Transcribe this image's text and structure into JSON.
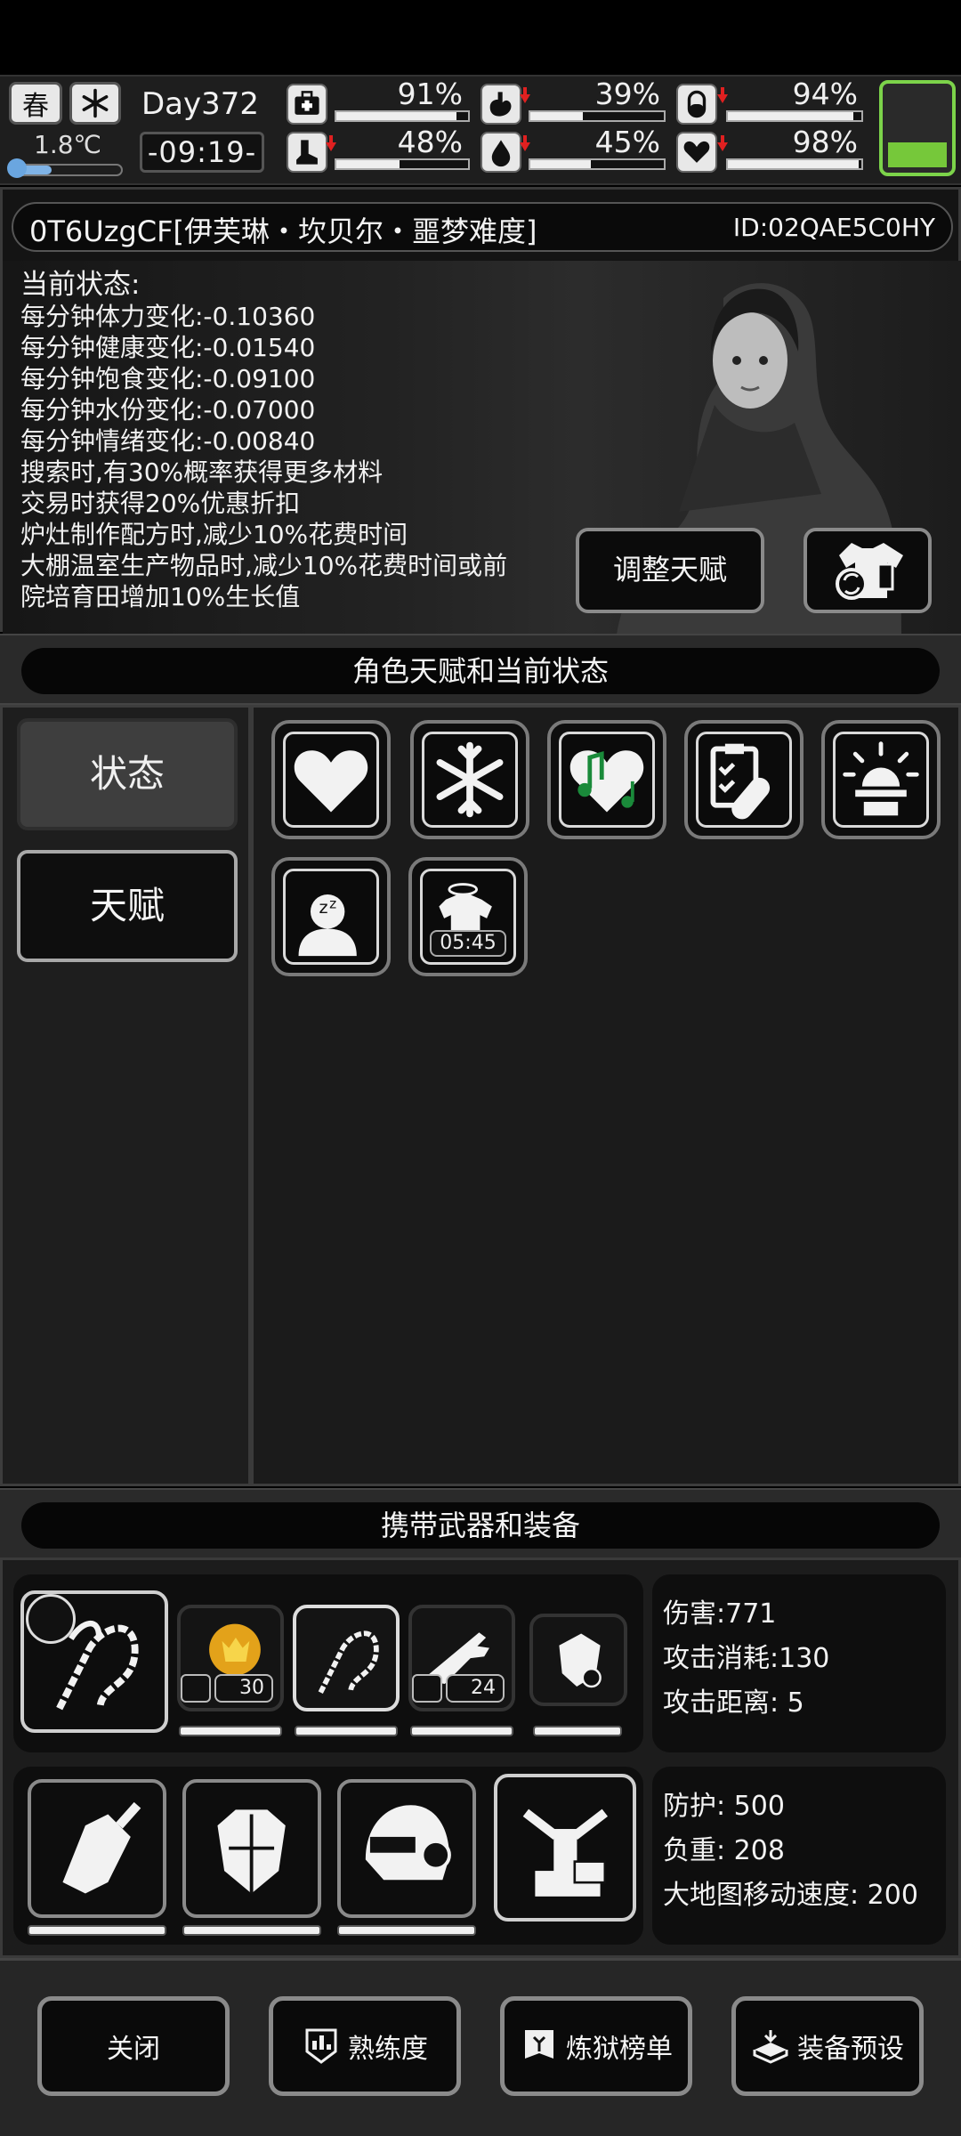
{
  "status_bar": {
    "season": "春",
    "temperature": "1.8℃",
    "temperature_level": 0.35,
    "day": "Day372",
    "time": "-09:19-",
    "battery_level": 0.28,
    "stats": [
      {
        "name": "health",
        "icon": "medkit-icon",
        "percent": "91%",
        "value": 0.91,
        "falling": false
      },
      {
        "name": "hunger",
        "icon": "stomach-icon",
        "percent": "39%",
        "value": 0.39,
        "falling": true
      },
      {
        "name": "medicine",
        "icon": "pill-icon",
        "percent": "94%",
        "value": 0.94,
        "falling": true
      },
      {
        "name": "stamina",
        "icon": "boot-icon",
        "percent": "48%",
        "value": 0.48,
        "falling": true
      },
      {
        "name": "water",
        "icon": "water-drop-icon",
        "percent": "45%",
        "value": 0.45,
        "falling": true
      },
      {
        "name": "mood",
        "icon": "heart-icon",
        "percent": "98%",
        "value": 0.98,
        "falling": true
      }
    ]
  },
  "character": {
    "name": "0T6UzgCF[伊芙琳・坎贝尔・噩梦难度]",
    "id": "ID:02QAE5C0HY",
    "status_title": "当前状态:",
    "status_lines": [
      "每分钟体力变化:-0.10360",
      "每分钟健康变化:-0.01540",
      "每分钟饱食变化:-0.09100",
      "每分钟水份变化:-0.07000",
      "每分钟情绪变化:-0.00840",
      "搜索时,有30%概率获得更多材料",
      "交易时获得20%优惠折扣",
      "炉灶制作配方时,减少10%花费时间",
      "大棚温室生产物品时,减少10%花费时间或前",
      "院培育田增加10%生长值"
    ],
    "adjust_talent_button": "调整天赋"
  },
  "talent_section": {
    "header": "角色天赋和当前状态",
    "tabs": [
      "状态",
      "天赋"
    ],
    "active_tab": "状态",
    "icons": [
      {
        "name": "heart-icon"
      },
      {
        "name": "snowflake-icon"
      },
      {
        "name": "music-heart-icon"
      },
      {
        "name": "clipboard-bandage-icon"
      },
      {
        "name": "alarm-light-icon"
      },
      {
        "name": "sleeping-person-icon"
      },
      {
        "name": "ghost-shirt-icon",
        "timer": "05:45"
      }
    ]
  },
  "equipment_section": {
    "header": "携带武器和装备",
    "weapons": [
      {
        "name": "bone-whip-icon",
        "durability": 0.9
      },
      {
        "name": "lion-emblem-icon",
        "count": "30",
        "durability": 0.95
      },
      {
        "name": "bone-whip-icon",
        "durability": 0.9
      },
      {
        "name": "rifle-icon",
        "count": "24",
        "durability": 0.95
      },
      {
        "name": "armored-glove-icon",
        "durability": 0.8
      }
    ],
    "armor": [
      {
        "name": "gauntlet-icon",
        "durability": 0.95
      },
      {
        "name": "chest-armor-icon",
        "durability": 0.95
      },
      {
        "name": "helmet-icon",
        "durability": 0.8
      },
      {
        "name": "backpack-frame-icon"
      }
    ],
    "weapon_stats": [
      "伤害:771",
      "攻击消耗:130",
      "攻击距离: 5"
    ],
    "armor_stats": [
      "防护: 500",
      "负重: 208",
      "大地图移动速度: 200"
    ]
  },
  "bottom_buttons": {
    "close": "关闭",
    "proficiency": "熟练度",
    "ranking": "炼狱榜单",
    "preset": "装备预设"
  }
}
